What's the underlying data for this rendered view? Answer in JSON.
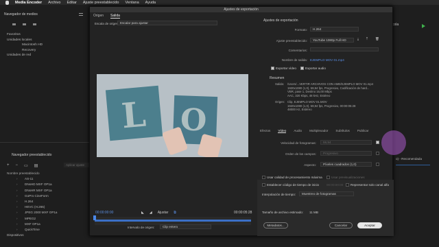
{
  "menubar": {
    "app": "Media Encoder",
    "items": [
      "Archivo",
      "Editar",
      "Ajuste preestablecido",
      "Ventana",
      "Ayuda"
    ]
  },
  "media_browser": {
    "title": "Navegador de medios",
    "tree": {
      "favorites": "Favoritos",
      "local": "Unidades locales",
      "drive1": "Macintosh HD",
      "drive2": "Recovery",
      "network": "Unidades de red"
    }
  },
  "preset_browser": {
    "title": "Navegador preestablecido",
    "search_placeholder": "Aplicar ajuste",
    "column": "Nombre preestablecido",
    "items": [
      "AS-11",
      "DNxHD MXF OP1a",
      "DNxHR MXF OP1a",
      "GoPro CineForm",
      "H.264",
      "HEVC (H.265)",
      "JPEG 2000 MXF OP1a",
      "MPEG2",
      "MXF OP1a",
      "QuickTime"
    ],
    "devices": "Dispositivos"
  },
  "host_right": {
    "fragment": "cola",
    "sel_text": "o) - Recomendada"
  },
  "dialog": {
    "title": "Ajustes de exportación",
    "tabs": [
      "Origen",
      "Salida"
    ],
    "scale_label": "Escala de origen:",
    "scale_value": "Escalar para ajustar",
    "timecode_in": "00:00:00:00",
    "timecode_out": "00:00:05:28",
    "fit_label": "Ajustar",
    "source_range_label": "Intervalo de origen:",
    "source_range_value": "Clip entero",
    "export_settings": {
      "header": "Ajustes de exportación",
      "format_label": "Formato:",
      "format_value": "H.264",
      "preset_label": "Ajuste preestablecido:",
      "preset_value": "YouTube 1080p Full HD",
      "comments_label": "Comentarios:",
      "output_label": "Nombre de salida:",
      "output_value": "EJEMPLO MOV 01.mp4",
      "export_video": "Exportar vídeo",
      "export_audio": "Exportar audio"
    },
    "summary": {
      "header": "Resumen",
      "output_label": "Salida:",
      "output_lines": [
        "/Users/...VERTIR ARCHIVOS CON AME/EJEMPLO MOV 01.mp4",
        "1920x1080 (1,0), 59,94 fps, Progresivo, Codificación de hard...",
        "VBR, pase 1, Destino 16,00 Mbps",
        "AAC, 320 Kbps, 48 kHz, Estéreo"
      ],
      "source_label": "Origen:",
      "source_lines": [
        "Clip, EJEMPLO MOV 01.MOV",
        "1920x1080 (1,0), 59,94 fps, Progresivo, 00:00:05:28",
        "48000 Hz, Estéreo"
      ]
    },
    "settings_tabs": [
      "Efectos",
      "Vídeo",
      "Audio",
      "Multiplexador",
      "Subtítulos",
      "Publicar"
    ],
    "video": {
      "fps_label": "Velocidad de fotogramas:",
      "fps_value": "59,94",
      "field_label": "Orden de los campos:",
      "field_value": "Progresivo",
      "aspect_label": "Aspecto:",
      "aspect_value": "Píxeles cuadrados (1,0)"
    },
    "options": {
      "max_quality": "Usar calidad de procesamiento máxima",
      "use_previews": "Usar previsualizaciones",
      "start_tc": "Establecer código de tiempo de inicio",
      "start_tc_value": "00:00:00:00",
      "alpha_only": "Representar solo canal alfa",
      "interp_label": "Interpolación de tiempo:",
      "interp_value": "Muestreo de fotogramas",
      "filesize_label": "Tamaño de archivo estimado:",
      "filesize_value": "11 MB"
    },
    "buttons": {
      "metadata": "Metadatos...",
      "cancel": "Cancelar",
      "ok": "Aceptar"
    }
  }
}
